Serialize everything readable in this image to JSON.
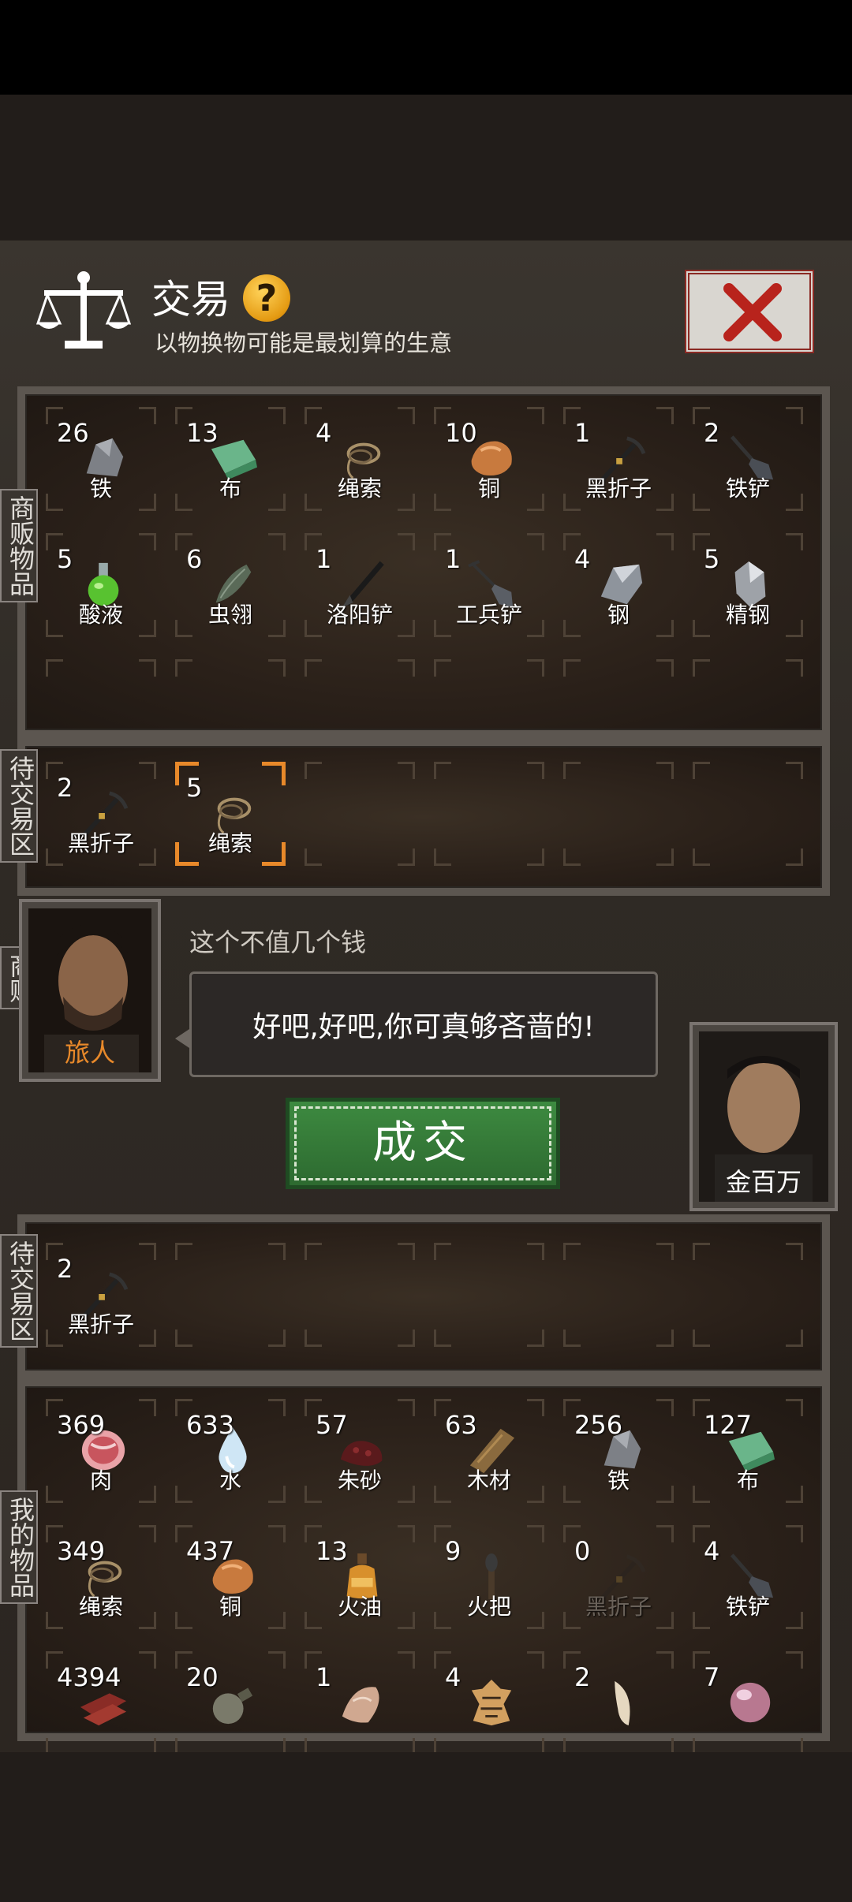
{
  "header": {
    "title": "交易",
    "help": "?",
    "subtitle": "以物换物可能是最划算的生意"
  },
  "labels": {
    "merchant_goods": "商贩物品",
    "merchant_pending": "待交易区",
    "merchant": "商贩",
    "my_pending": "待交易区",
    "my_goods": "我的物品"
  },
  "merchant_items": [
    {
      "count": "26",
      "name": "铁",
      "icon": "iron-ore-icon"
    },
    {
      "count": "13",
      "name": "布",
      "icon": "cloth-icon"
    },
    {
      "count": "4",
      "name": "绳索",
      "icon": "rope-icon"
    },
    {
      "count": "10",
      "name": "铜",
      "icon": "copper-ore-icon"
    },
    {
      "count": "1",
      "name": "黑折子",
      "icon": "black-pick-icon"
    },
    {
      "count": "2",
      "name": "铁铲",
      "icon": "shovel-icon"
    },
    {
      "count": "5",
      "name": "酸液",
      "icon": "acid-flask-icon"
    },
    {
      "count": "6",
      "name": "虫翎",
      "icon": "insect-wing-icon"
    },
    {
      "count": "1",
      "name": "洛阳铲",
      "icon": "luoyang-shovel-icon"
    },
    {
      "count": "1",
      "name": "工兵铲",
      "icon": "sapper-shovel-icon"
    },
    {
      "count": "4",
      "name": "钢",
      "icon": "steel-icon"
    },
    {
      "count": "5",
      "name": "精钢",
      "icon": "fine-steel-icon"
    }
  ],
  "merchant_pending": [
    {
      "count": "2",
      "name": "黑折子",
      "icon": "black-pick-icon"
    },
    {
      "count": "5",
      "name": "绳索",
      "icon": "rope-icon"
    }
  ],
  "trader": {
    "name": "旅人",
    "remark": "这个不值几个钱",
    "speech": "好吧,好吧,你可真够吝啬的!"
  },
  "deal_button": "成交",
  "player": {
    "name": "金百万",
    "stars": "★★"
  },
  "my_pending": [
    {
      "count": "2",
      "name": "黑折子",
      "icon": "black-pick-icon"
    }
  ],
  "my_items": [
    {
      "count": "369",
      "name": "肉",
      "icon": "meat-icon"
    },
    {
      "count": "633",
      "name": "水",
      "icon": "water-drop-icon"
    },
    {
      "count": "57",
      "name": "朱砂",
      "icon": "cinnabar-icon"
    },
    {
      "count": "63",
      "name": "木材",
      "icon": "wood-icon"
    },
    {
      "count": "256",
      "name": "铁",
      "icon": "iron-ore-icon"
    },
    {
      "count": "127",
      "name": "布",
      "icon": "cloth-icon"
    },
    {
      "count": "349",
      "name": "绳索",
      "icon": "rope-icon"
    },
    {
      "count": "437",
      "name": "铜",
      "icon": "copper-ore-icon"
    },
    {
      "count": "13",
      "name": "火油",
      "icon": "oil-bottle-icon"
    },
    {
      "count": "9",
      "name": "火把",
      "icon": "torch-icon"
    },
    {
      "count": "0",
      "name": "黑折子",
      "icon": "black-pick-icon"
    },
    {
      "count": "4",
      "name": "铁铲",
      "icon": "shovel-icon"
    },
    {
      "count": "4394",
      "name": "",
      "icon": "jerky-icon"
    },
    {
      "count": "20",
      "name": "",
      "icon": "gourd-bottle-icon"
    },
    {
      "count": "1",
      "name": "",
      "icon": "fang-fragment-icon"
    },
    {
      "count": "4",
      "name": "",
      "icon": "tiger-pelt-icon"
    },
    {
      "count": "2",
      "name": "",
      "icon": "claw-icon"
    },
    {
      "count": "7",
      "name": "",
      "icon": "pearl-icon"
    }
  ],
  "colors": {
    "accent_orange": "#e8892a",
    "deal_green": "#2d6a30",
    "close_red": "#8b2a24"
  }
}
